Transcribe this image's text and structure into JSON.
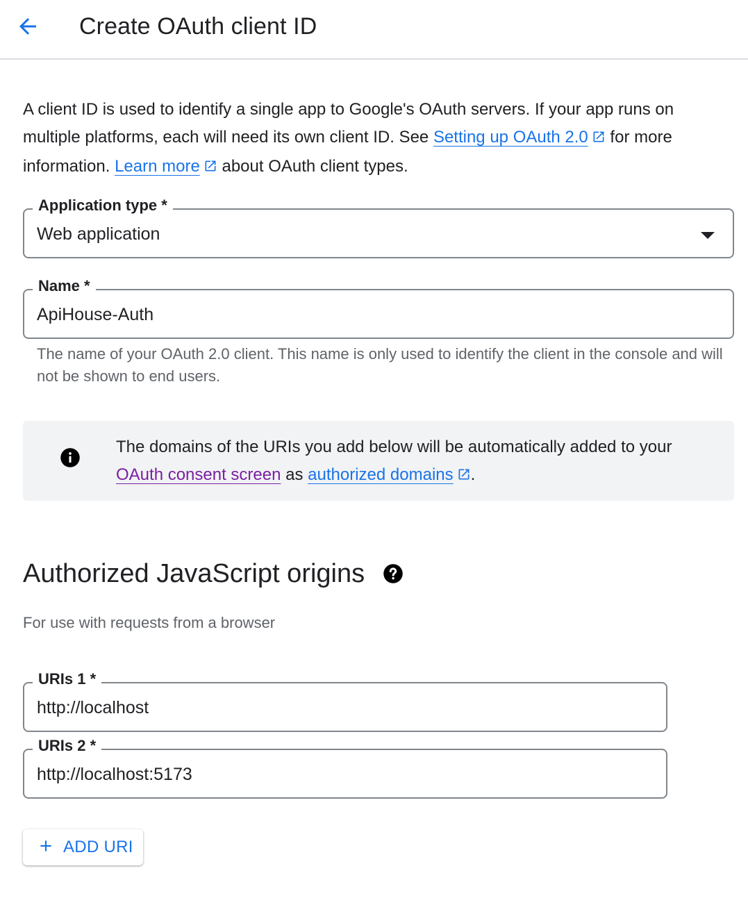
{
  "header": {
    "title": "Create OAuth client ID",
    "back_icon": "arrow-back-icon"
  },
  "intro": {
    "text_before": "A client ID is used to identify a single app to Google's OAuth servers. If your app runs on multiple platforms, each will need its own client ID. See ",
    "link1_label": "Setting up OAuth 2.0",
    "text_middle": " for more information. ",
    "link2_label": "Learn more",
    "text_after": " about OAuth client types."
  },
  "application_type": {
    "label": "Application type *",
    "value": "Web application"
  },
  "name_field": {
    "label": "Name *",
    "value": "ApiHouse-Auth",
    "helper": "The name of your OAuth 2.0 client. This name is only used to identify the client in the console and will not be shown to end users."
  },
  "info_banner": {
    "text_before": "The domains of the URIs you add below will be automatically added to your ",
    "link1_label": "OAuth consent screen",
    "text_middle": " as ",
    "link2_label": "authorized domains",
    "text_after": "."
  },
  "js_origins": {
    "title": "Authorized JavaScript origins",
    "subtitle": "For use with requests from a browser",
    "uris": [
      {
        "label": "URIs 1 *",
        "value": "http://localhost"
      },
      {
        "label": "URIs 2 *",
        "value": "http://localhost:5173"
      }
    ],
    "add_button_label": "ADD URI"
  },
  "colors": {
    "accent": "#1a73e8",
    "visited_link": "#7b1fa2",
    "banner_bg": "#f1f3f4",
    "border": "#80868b"
  }
}
